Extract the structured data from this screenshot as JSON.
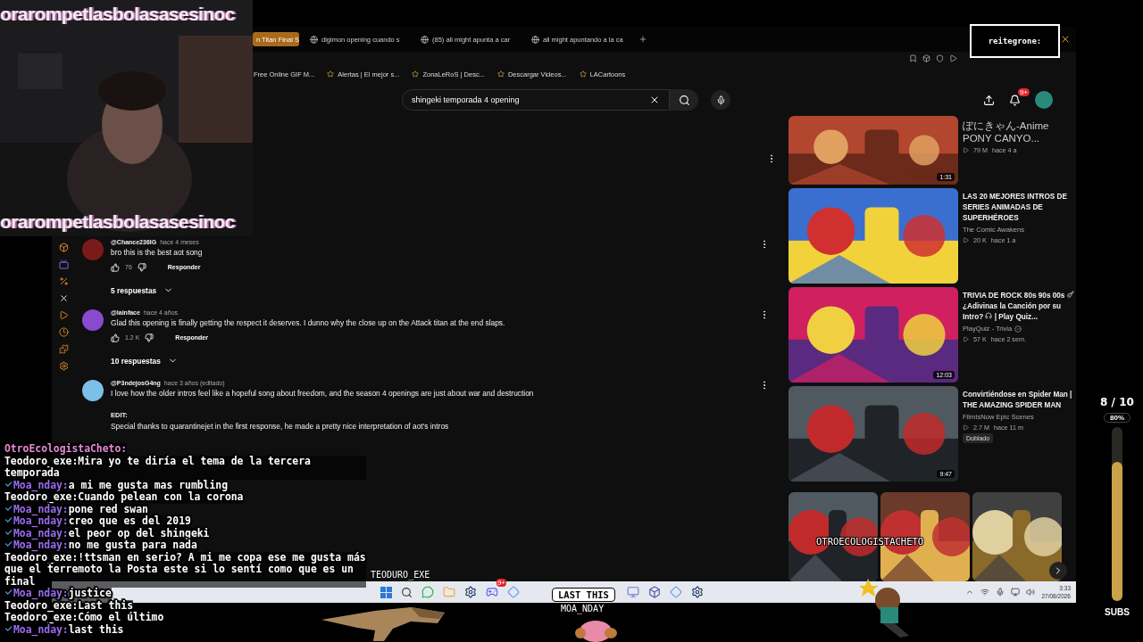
{
  "webcam": {
    "kind": "picture",
    "banner_top": "orarompetlasbolasasesinoc",
    "banner_bottom": "orarompetlasbolasasesinoc"
  },
  "streamer_name": "reitegrone:",
  "browser": {
    "tabs": [
      {
        "label": "n Titan Final S",
        "selected": true
      },
      {
        "label": "digimon opening cuando s",
        "selected": false
      },
      {
        "label": "(85) all might apunta a car",
        "selected": false
      },
      {
        "label": "all might apuntando a la ca",
        "selected": false
      }
    ],
    "bookmarks": [
      {
        "label": "Free Online GIF M..."
      },
      {
        "label": "Alertas | El mejor s..."
      },
      {
        "label": "ZonaLeRoS | Desc..."
      },
      {
        "label": "Descargar Videos..."
      },
      {
        "label": "LACartoons"
      }
    ],
    "search": {
      "value": "shingeki temporada 4 opening"
    },
    "notifications": "9+"
  },
  "comments": [
    {
      "author": "@Chance236IG",
      "time": "hace 4 meses",
      "text": "bro this is the best aot song",
      "likes": "76",
      "reply": "Responder",
      "replies": "5 respuestas"
    },
    {
      "author": "@lainface",
      "time": "hace 4 años",
      "text": "Glad this opening is finally getting the respect it deserves. I dunno why the close up on the Attack titan at the end slaps.",
      "likes": "1.2 K",
      "reply": "Responder",
      "replies": "10 respuestas"
    },
    {
      "author": "@P3ndejosG4ng",
      "time": "hace 3 años (editado)",
      "text": "I love how the older intros feel like a hopeful song about freedom, and the season 4 openings are just about war and destruction",
      "edit_label": "EDIT:",
      "edit_text": "Special thanks to quarantinejet in the first response, he made a pretty nice interpretation of aot's intros"
    }
  ],
  "recommendations": [
    {
      "channel": "ぽにきゃん-Anime PONY CANYO...",
      "verified": false,
      "views": "79 M",
      "age": "hace 4 a",
      "duration": "1:31"
    },
    {
      "title": [
        "LAS 20 MEJORES INTROS DE SERIES ANIMADAS DE SUPERHÉROES"
      ],
      "channel": "The Comic Awakens",
      "verified": false,
      "views": "20 K",
      "age": "hace 1 a"
    },
    {
      "title": [
        "TRIVIA DE ROCK 80s 90s 00s",
        "¿Adivinas la Canción por su Intro?",
        "| Play Quiz..."
      ],
      "channel": "PlayQuiz - Trivia",
      "verified": true,
      "views": "57 K",
      "age": "hace 2 sem.",
      "duration": "12:03"
    },
    {
      "title": [
        "Convirtiéndose en Spider Man | THE AMAZING SPIDER MAN"
      ],
      "channel": "FilmIsNow Epic Scenes",
      "verified": false,
      "views": "2.7 M",
      "age": "hace 11 m",
      "duration": "9:47",
      "badge": "Doblado"
    }
  ],
  "alert_text": "OTROECOLOGISTACHETO",
  "chat": [
    {
      "user": "OtroEcologistaCheto:",
      "color": "#e58ad6",
      "badge": false
    },
    {
      "user": "Teodoro_exe:",
      "color": "#ffffff",
      "badge": false,
      "message": "Mira yo te diría el tema de la tercera temporada"
    },
    {
      "user": "Moa_nday:",
      "color": "#9b6cf0",
      "badge": true,
      "message": "a mi me gusta mas rumbling"
    },
    {
      "user": "Teodoro_exe:",
      "color": "#ffffff",
      "badge": false,
      "message": "Cuando pelean con la corona"
    },
    {
      "user": "Moa_nday:",
      "color": "#9b6cf0",
      "badge": true,
      "message": "pone red swan"
    },
    {
      "user": "Moa_nday:",
      "color": "#9b6cf0",
      "badge": true,
      "message": "creo que es del 2019"
    },
    {
      "user": "Moa_nday:",
      "color": "#9b6cf0",
      "badge": true,
      "message": "el peor op del shingeki"
    },
    {
      "user": "Moa_nday:",
      "color": "#9b6cf0",
      "badge": true,
      "message": "no me gusta para nada"
    },
    {
      "user": "Teodoro_exe:",
      "color": "#ffffff",
      "badge": false,
      "message": "!ttsman en serio? A mi me copa ese me gusta más que el terremoto la Posta este si lo sentí como que es un final"
    },
    {
      "user": "Moa_nday:",
      "color": "#9b6cf0",
      "badge": true,
      "message": "justice"
    },
    {
      "user": "Teodoro_exe:",
      "color": "#ffffff",
      "badge": false,
      "message": "Last this"
    },
    {
      "user": "Teodoro_exe:",
      "color": "#ffffff",
      "badge": false,
      "message": "Cómo el último"
    },
    {
      "user": "Moa_nday:",
      "color": "#9b6cf0",
      "badge": true,
      "message": "last this"
    }
  ],
  "taskbar": {
    "app_badge": "9+",
    "time": "3:33",
    "date": "27/08/2026"
  },
  "sprites": {
    "dino_label": "TEODURO_EXE",
    "bubble": "LAST THIS",
    "bubble_user": "MOA_NDAY"
  },
  "sub_goal": {
    "count": "8 / 10",
    "percent": "80%",
    "level": 0.8,
    "label": "SUBS"
  }
}
